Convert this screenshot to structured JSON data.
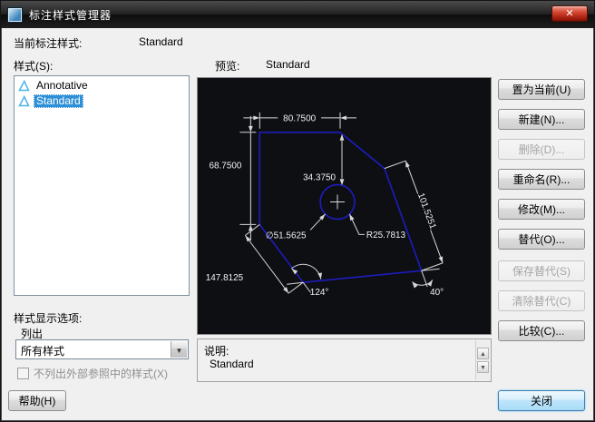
{
  "window": {
    "title": "标注样式管理器"
  },
  "icons": {
    "close": "✕",
    "dropdown_arrow": "▼",
    "scroll_up": "▲",
    "scroll_down": "▼"
  },
  "header": {
    "current_style_label": "当前标注样式:",
    "current_style_value": "Standard"
  },
  "styles_panel": {
    "label": "样式(S):",
    "items": [
      {
        "name": "Annotative",
        "selected": false
      },
      {
        "name": "Standard",
        "selected": true
      }
    ]
  },
  "preview": {
    "label": "预览:",
    "style_name": "Standard",
    "dimensions": {
      "top": "80.7500",
      "left": "68.7500",
      "middle": "34.3750",
      "right": "101.5251",
      "diameter": "∅51.5625",
      "radius": "R25.7813",
      "lower_left": "147.8125",
      "angle_bottom": "124°",
      "angle_right": "40°"
    }
  },
  "list_options": {
    "group_label": "样式显示选项:",
    "list_label": "列出",
    "dropdown_value": "所有样式",
    "checkbox_label": "不列出外部参照中的样式(X)",
    "checkbox_checked": false
  },
  "description": {
    "label": "说明:",
    "value": "Standard"
  },
  "action_buttons": [
    {
      "label": "置为当前(U)",
      "enabled": true
    },
    {
      "label": "新建(N)...",
      "enabled": true
    },
    {
      "label": "删除(D)...",
      "enabled": false
    },
    {
      "label": "重命名(R)...",
      "enabled": true
    },
    {
      "label": "修改(M)...",
      "enabled": true
    },
    {
      "label": "替代(O)...",
      "enabled": true
    },
    {
      "label": "保存替代(S)",
      "enabled": false
    },
    {
      "label": "清除替代(C)",
      "enabled": false
    },
    {
      "label": "比较(C)...",
      "enabled": true
    }
  ],
  "footer": {
    "help_label": "帮助(H)",
    "close_label": "关闭"
  },
  "colors": {
    "selection": "#2d8fd5",
    "preview_bg": "#0d0f13",
    "shape_line": "#1d1dbe",
    "dim_line": "#d8d8d8",
    "titlebar": "#1e1e1e",
    "close_red": "#bb2c1a"
  }
}
